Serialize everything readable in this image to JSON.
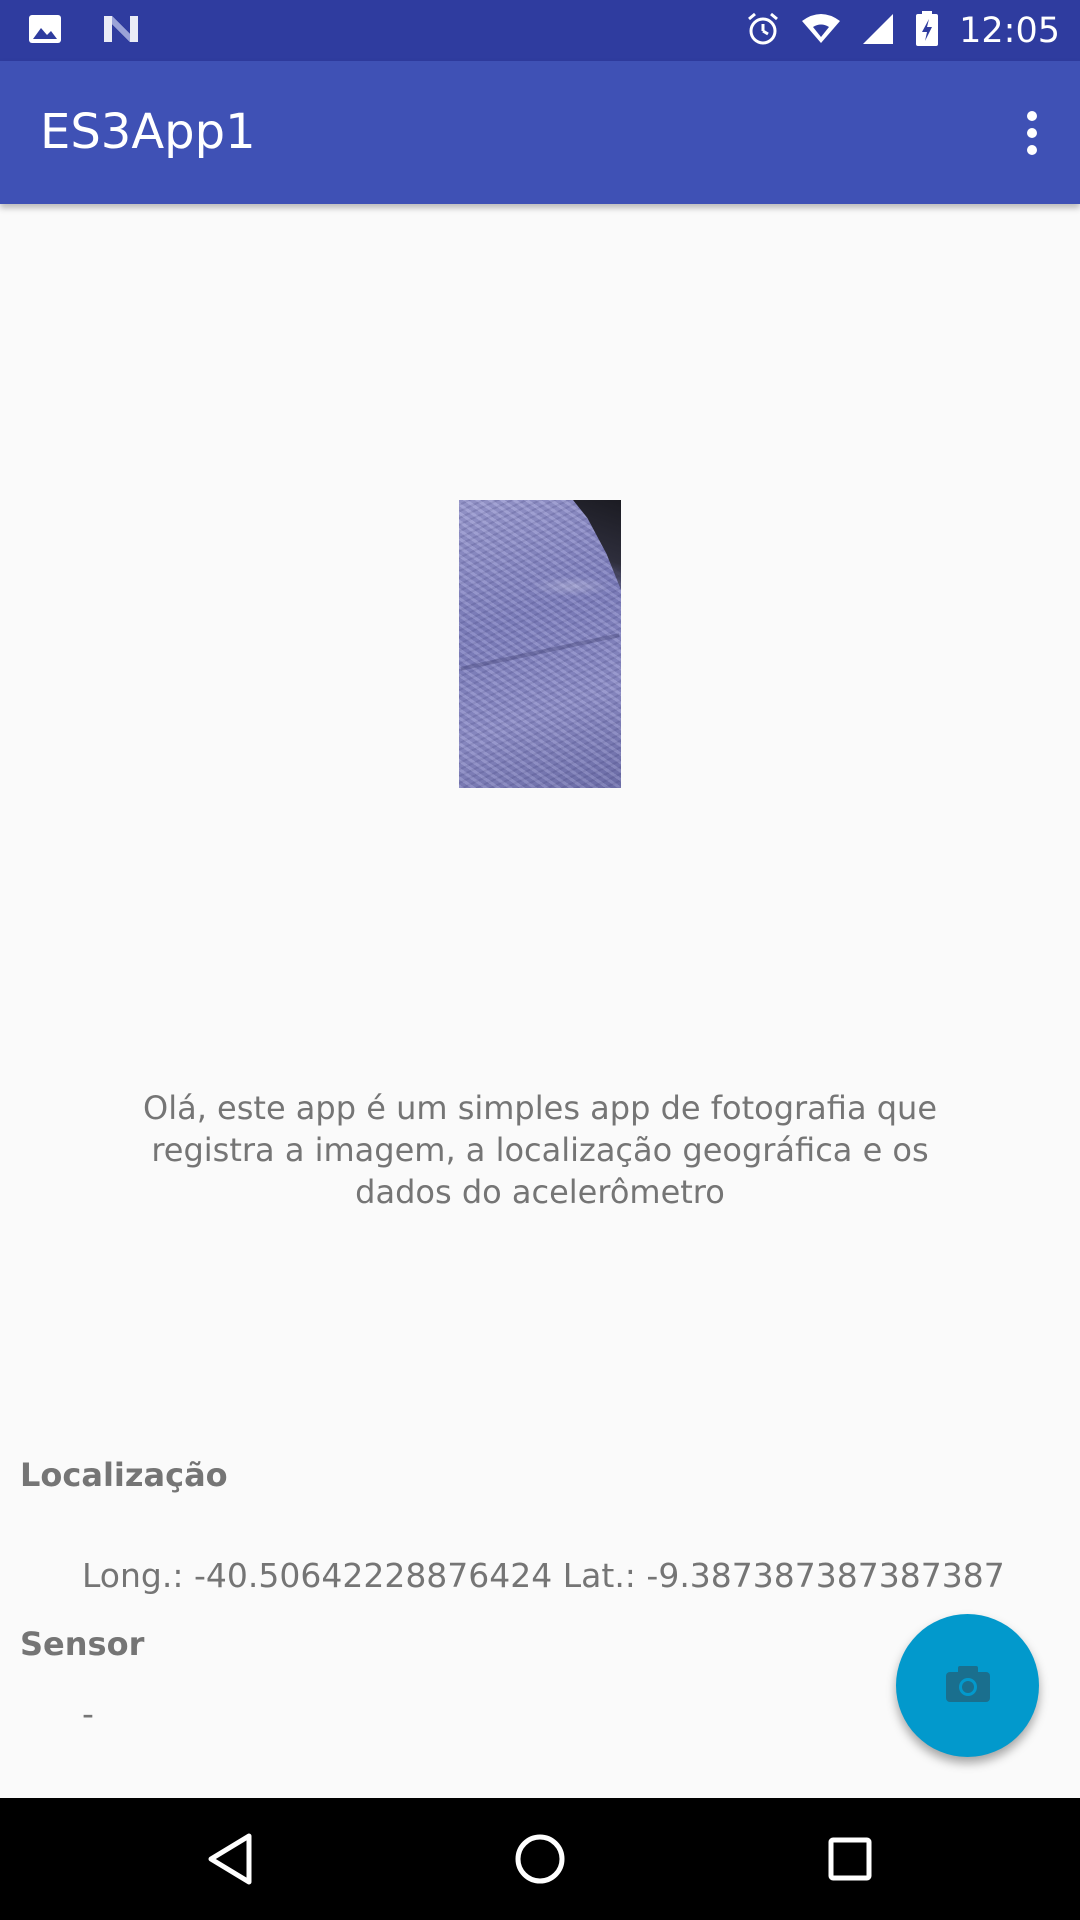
{
  "status_bar": {
    "time": "12:05",
    "icons": [
      "image-icon",
      "n-logo-icon",
      "alarm-icon",
      "wifi-icon",
      "signal-icon",
      "battery-charging-icon"
    ]
  },
  "app_bar": {
    "title": "ES3App1",
    "overflow_icon": "more-vert-icon"
  },
  "main": {
    "photo_icon": "captured-photo",
    "intro_text": "Olá, este app é um simples app de fotografia que registra a imagem, a localização geográfica e os dados do acelerômetro",
    "location_label": "Localização",
    "location_value": "Long.: -40.50642228876424 Lat.: -9.387387387387387",
    "sensor_label": "Sensor",
    "sensor_value": "-"
  },
  "fab": {
    "icon": "camera-icon"
  },
  "nav_bar": {
    "icons": [
      "back-icon",
      "home-icon",
      "recents-icon"
    ]
  },
  "colors": {
    "status_bar": "#2f3c9f",
    "app_bar": "#3f51b5",
    "fab": "#0299cc",
    "background": "#fafafa",
    "text": "#757575"
  }
}
